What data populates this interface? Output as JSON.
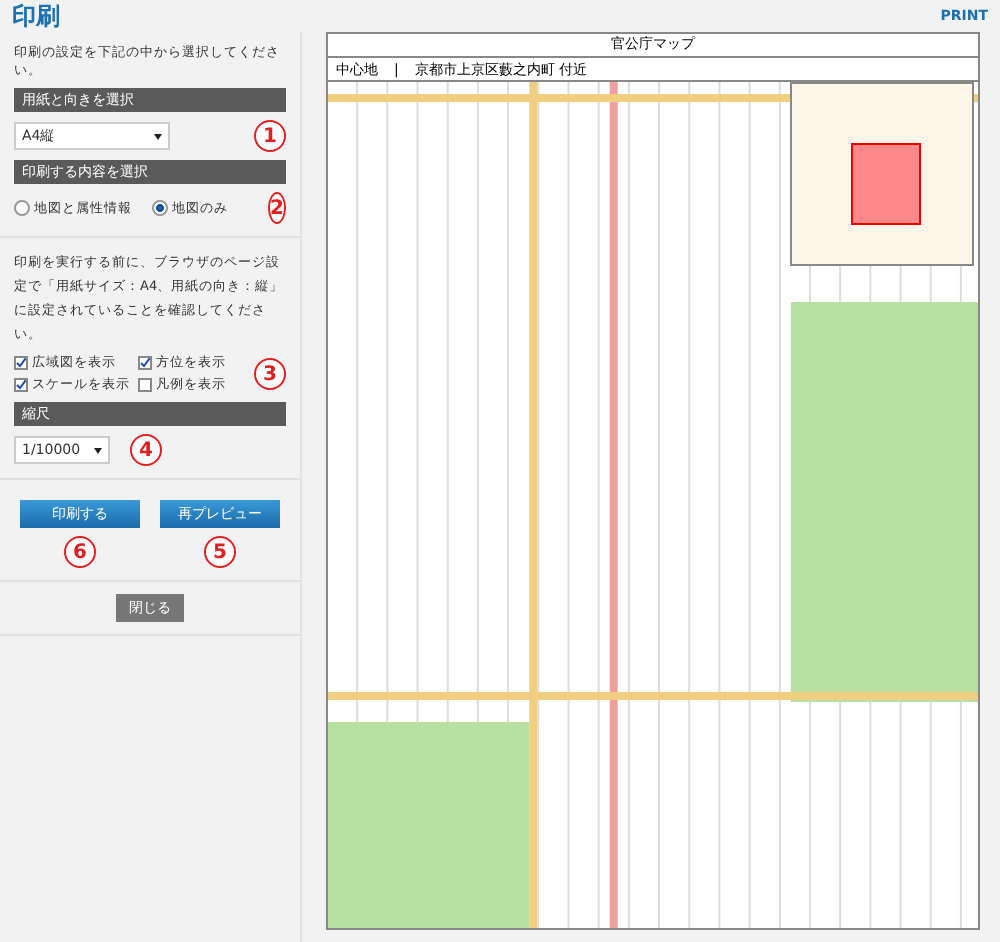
{
  "header": {
    "title": "印刷",
    "print_label": "PRINT"
  },
  "panel": {
    "intro": "印刷の設定を下記の中から選択してください。",
    "paper_section": {
      "heading": "用紙と向きを選択",
      "select_value": "A4縦",
      "marker": "1"
    },
    "content_section": {
      "heading": "印刷する内容を選択",
      "marker": "2",
      "options": [
        {
          "label": "地図と属性情報",
          "selected": false
        },
        {
          "label": "地図のみ",
          "selected": true
        }
      ]
    },
    "notice": "印刷を実行する前に、ブラウザのページ設定で「用紙サイズ：A4、用紙の向き：縦」に設定されていることを確認してください。",
    "checkboxes": [
      {
        "label": "広域図を表示",
        "checked": true
      },
      {
        "label": "方位を表示",
        "checked": true
      },
      {
        "label": "スケールを表示",
        "checked": true
      },
      {
        "label": "凡例を表示",
        "checked": false
      }
    ],
    "checkbox_marker": "3",
    "scale_section": {
      "heading": "縮尺",
      "select_value": "1/10000",
      "marker": "4"
    },
    "buttons": [
      {
        "label": "印刷する",
        "marker": "6"
      },
      {
        "label": "再プレビュー",
        "marker": "5"
      }
    ],
    "close_button": "閉じる"
  },
  "map": {
    "title": "官公庁マップ",
    "center_label": "中心地",
    "separator": "|",
    "location": "京都市上京区藪之内町 付近"
  }
}
